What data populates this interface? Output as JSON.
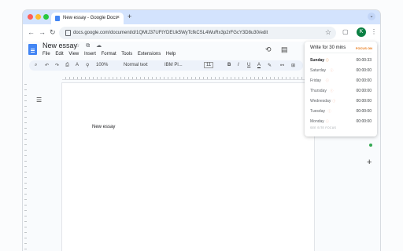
{
  "browser": {
    "tab_title": "New essay - Google Docs",
    "tab_close": "×",
    "new_tab": "+",
    "tab_menu": "⌄",
    "url": "docs.google.com/document/d/1QMtJ37UFtYDEUk5WyTcfkCSL4WuRx3p2rFGcY3D8u30/edit",
    "back": "←",
    "forward": "→",
    "reload": "↻",
    "star": "☆",
    "extensions_icon": "▢",
    "avatar_letter": "K",
    "kebab": "⋮",
    "traffic_colors": [
      "#fe5f57",
      "#febc2e",
      "#28c840"
    ]
  },
  "docs": {
    "title": "New essay",
    "title_icons": "☆ ⧉ ☁",
    "menu": [
      "File",
      "Edit",
      "View",
      "Insert",
      "Format",
      "Tools",
      "Extensions",
      "Help"
    ],
    "history_icon": "⟲",
    "comments_icon": "▤",
    "toolbar": {
      "search": "⌕",
      "undo": "↶",
      "redo": "↷",
      "print": "⎙",
      "spell": "A",
      "paint": "⚲",
      "zoom": "100%",
      "style": "Normal text",
      "font": "IBM Pl...",
      "font_size": "11",
      "bold": "B",
      "italic": "I",
      "underline": "U",
      "text_color": "A",
      "highlight": "✎",
      "link": "⚯",
      "comment": "⊞"
    },
    "outline_icon": "☰",
    "body_text": "New essay",
    "side_add": "+"
  },
  "popup": {
    "title": "Write for 30 mins",
    "status": "FOCUS ON",
    "rows": [
      {
        "day": "Sunday",
        "time": "00:00:33",
        "active": true
      },
      {
        "day": "Saturday",
        "time": "00:00:00",
        "active": false
      },
      {
        "day": "Friday",
        "time": "00:00:00",
        "active": false
      },
      {
        "day": "Thursday",
        "time": "00:00:00",
        "active": false
      },
      {
        "day": "Wednesday",
        "time": "00:00:00",
        "active": false
      },
      {
        "day": "Tuesday",
        "time": "00:00:00",
        "active": false
      },
      {
        "day": "Monday",
        "time": "00:00:00",
        "active": false
      }
    ],
    "footer": "SEE SITE FOCUS"
  }
}
